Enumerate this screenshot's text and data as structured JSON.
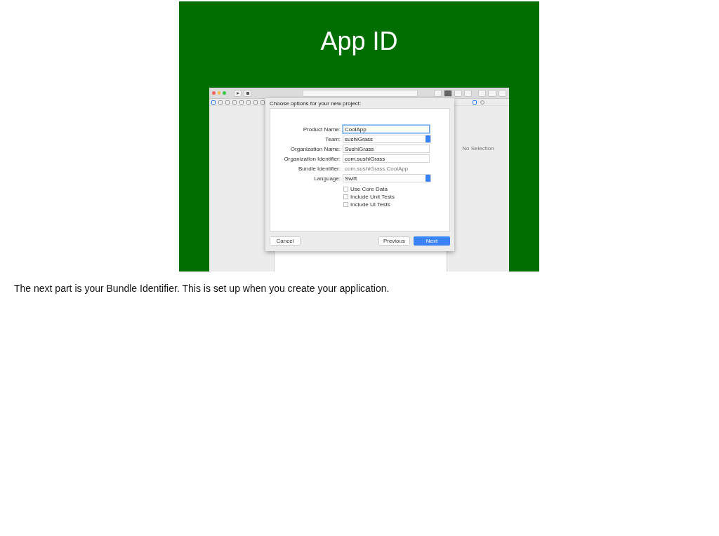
{
  "slide": {
    "title": "App ID"
  },
  "xcode": {
    "sheet": {
      "heading": "Choose options for your new project:",
      "fields": [
        {
          "kind": "text",
          "label": "Product Name:",
          "value": "CoolApp",
          "focused": true
        },
        {
          "kind": "popup",
          "label": "Team:",
          "value": "sushiGrass"
        },
        {
          "kind": "text",
          "label": "Organization Name:",
          "value": "SushiGrass",
          "focused": false
        },
        {
          "kind": "text",
          "label": "Organization Identifier:",
          "value": "com.sushiGrass",
          "focused": false
        },
        {
          "kind": "static",
          "label": "Bundle Identifier:",
          "value": "com.sushiGrass.CoolApp"
        },
        {
          "kind": "popup",
          "label": "Language:",
          "value": "Swift"
        }
      ],
      "checkboxes": [
        {
          "label": "Use Core Data",
          "checked": false
        },
        {
          "label": "Include Unit Tests",
          "checked": false
        },
        {
          "label": "Include UI Tests",
          "checked": false
        }
      ],
      "buttons": [
        {
          "label": "Cancel",
          "default": false
        },
        {
          "label": "Previous",
          "default": false
        },
        {
          "label": "Next",
          "default": true
        }
      ]
    },
    "inspector": {
      "empty_text": "No Selection"
    }
  },
  "notes": "The next part is your Bundle Identifier. This is set up when you create your application."
}
